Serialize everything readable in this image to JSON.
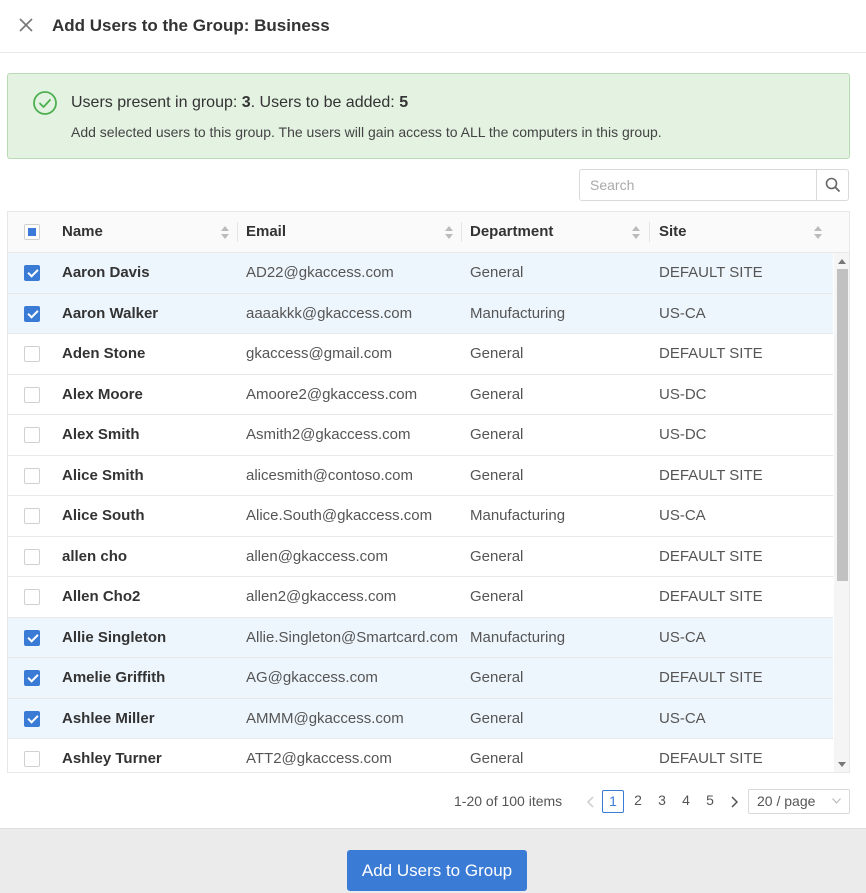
{
  "dialog": {
    "title": "Add Users to the Group: Business"
  },
  "alert": {
    "present_label": "Users present in group: ",
    "present_count": "3",
    "added_label": ". Users to be added: ",
    "added_count": "5",
    "description": "Add selected users to this group. The users will gain access to ALL the computers in this group.",
    "color": "#e3f2e1"
  },
  "search": {
    "placeholder": "Search"
  },
  "table": {
    "columns": [
      "Name",
      "Email",
      "Department",
      "Site"
    ],
    "rows": [
      {
        "name": "Aaron Davis",
        "email": "AD22@gkaccess.com",
        "department": "General",
        "site": "DEFAULT SITE",
        "checked": true
      },
      {
        "name": "Aaron Walker",
        "email": "aaaakkk@gkaccess.com",
        "department": "Manufacturing",
        "site": "US-CA",
        "checked": true
      },
      {
        "name": "Aden Stone",
        "email": "gkaccess@gmail.com",
        "department": "General",
        "site": "DEFAULT SITE",
        "checked": false
      },
      {
        "name": "Alex Moore",
        "email": "Amoore2@gkaccess.com",
        "department": "General",
        "site": "US-DC",
        "checked": false
      },
      {
        "name": "Alex Smith",
        "email": "Asmith2@gkaccess.com",
        "department": "General",
        "site": "US-DC",
        "checked": false
      },
      {
        "name": "Alice Smith",
        "email": "alicesmith@contoso.com",
        "department": "General",
        "site": "DEFAULT SITE",
        "checked": false
      },
      {
        "name": "Alice South",
        "email": "Alice.South@gkaccess.com",
        "department": "Manufacturing",
        "site": "US-CA",
        "checked": false
      },
      {
        "name": "allen cho",
        "email": "allen@gkaccess.com",
        "department": "General",
        "site": "DEFAULT SITE",
        "checked": false
      },
      {
        "name": "Allen Cho2",
        "email": "allen2@gkaccess.com",
        "department": "General",
        "site": "DEFAULT SITE",
        "checked": false
      },
      {
        "name": "Allie Singleton",
        "email": "Allie.Singleton@Smartcard.com",
        "department": "Manufacturing",
        "site": "US-CA",
        "checked": true
      },
      {
        "name": "Amelie Griffith",
        "email": "AG@gkaccess.com",
        "department": "General",
        "site": "DEFAULT SITE",
        "checked": true
      },
      {
        "name": "Ashlee Miller",
        "email": "AMMM@gkaccess.com",
        "department": "General",
        "site": "US-CA",
        "checked": true
      },
      {
        "name": "Ashley Turner",
        "email": "ATT2@gkaccess.com",
        "department": "General",
        "site": "DEFAULT SITE",
        "checked": false
      }
    ]
  },
  "pagination": {
    "total_text": "1-20 of 100 items",
    "pages": [
      "1",
      "2",
      "3",
      "4",
      "5"
    ],
    "current_page": "1",
    "page_size": "20 / page"
  },
  "footer": {
    "primary_label": "Add Users to Group"
  },
  "colors": {
    "accent": "#3a7bd5",
    "selected_row": "#eef6fd",
    "success_icon": "#4caf50"
  }
}
